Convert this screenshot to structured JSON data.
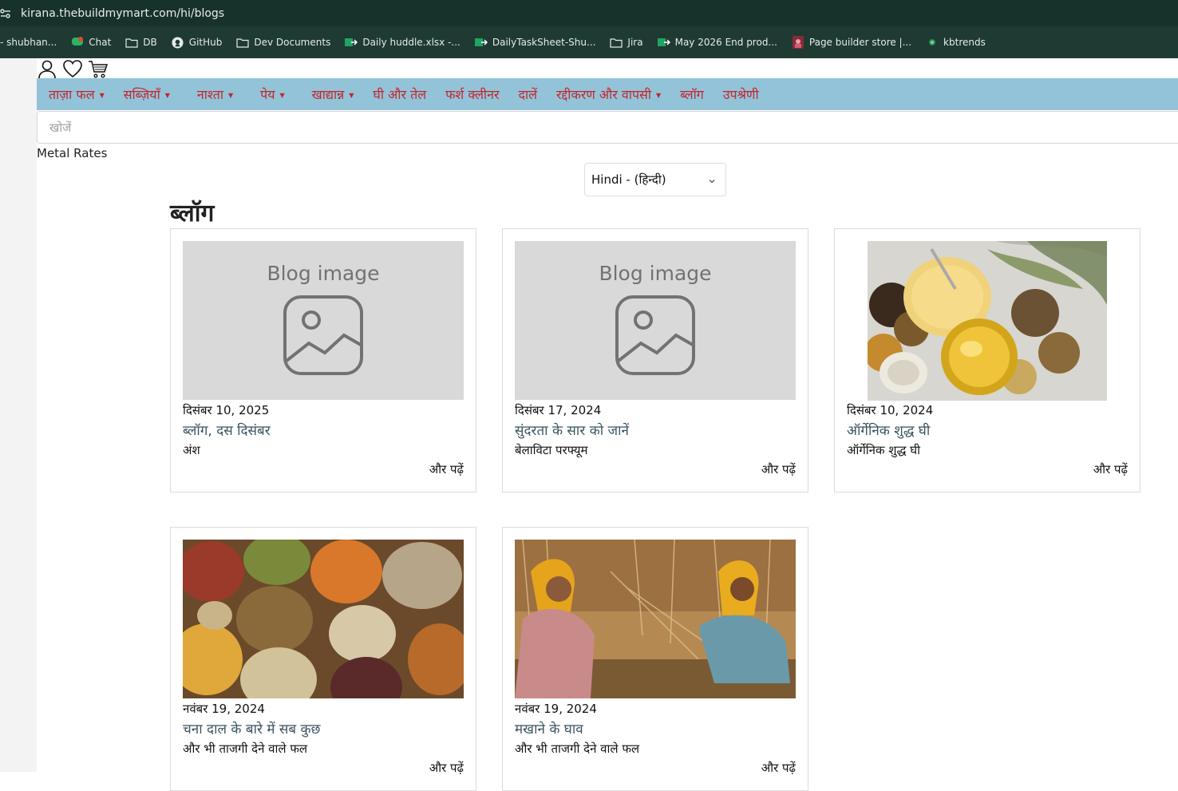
{
  "browser": {
    "url": "kirana.thebuildmymart.com/hi/blogs",
    "bookmarks": [
      {
        "label": "- shubhan...",
        "icon": "none"
      },
      {
        "label": "Chat",
        "icon": "chat-icon"
      },
      {
        "label": "DB",
        "icon": "folder-icon"
      },
      {
        "label": "GitHub",
        "icon": "github-icon"
      },
      {
        "label": "Dev Documents",
        "icon": "folder-icon"
      },
      {
        "label": "Daily huddle.xlsx -...",
        "icon": "sheet-icon"
      },
      {
        "label": "DailyTaskSheet-Shu...",
        "icon": "sheet-icon"
      },
      {
        "label": "Jira",
        "icon": "folder-icon"
      },
      {
        "label": "May 2026 End prod...",
        "icon": "sheet-icon"
      },
      {
        "label": "Page builder store |...",
        "icon": "store-icon"
      },
      {
        "label": "kbtrends",
        "icon": "leaf-icon"
      }
    ]
  },
  "nav": {
    "items": [
      {
        "label": "ताज़ा फल",
        "dropdown": true
      },
      {
        "label": "सब्ज़ियाँ",
        "dropdown": true
      },
      {
        "label": "नाश्ता",
        "dropdown": true
      },
      {
        "label": "पेय",
        "dropdown": true
      },
      {
        "label": "खाद्यान्न",
        "dropdown": true
      },
      {
        "label": "घी और तेल",
        "dropdown": false
      },
      {
        "label": "फर्श क्लीनर",
        "dropdown": false
      },
      {
        "label": "दालें",
        "dropdown": false
      },
      {
        "label": "रद्दीकरण और वापसी",
        "dropdown": true
      },
      {
        "label": "ब्लॉग",
        "dropdown": false
      },
      {
        "label": "उपश्रेणी",
        "dropdown": false
      }
    ]
  },
  "search": {
    "placeholder": "खोजें"
  },
  "metal_rates": "Metal Rates",
  "language": {
    "selected": "Hindi - (हिन्दी)"
  },
  "page_title": "ब्लॉग",
  "placeholder_text": "Blog image",
  "colors": {
    "nav_bg": "#93c3d8",
    "nav_text": "#c2262e",
    "chrome_bg": "#17322b"
  },
  "posts": [
    {
      "date": "दिसंबर 10, 2025",
      "title": "ब्लॉग, दस दिसंबर",
      "excerpt": "अंश",
      "read_more": "और पढ़ें",
      "image": "placeholder"
    },
    {
      "date": "दिसंबर 17, 2024",
      "title": "सुंदरता के सार को जानें",
      "excerpt": "बेलाविटा परफ्यूम",
      "read_more": "और पढ़ें",
      "image": "placeholder"
    },
    {
      "date": "दिसंबर 10, 2024",
      "title": "ऑर्गेनिक शुद्ध घी",
      "excerpt": "ऑर्गेनिक शुद्ध घी",
      "read_more": "और पढ़ें",
      "image": "ghee-photo"
    },
    {
      "date": "नवंबर 19, 2024",
      "title": "चना दाल के बारे में सब कुछ",
      "excerpt": "और भी ताजगी देने वाले फल",
      "read_more": "और पढ़ें",
      "image": "grains-photo"
    },
    {
      "date": "नवंबर 19, 2024",
      "title": "मखाने के घाव",
      "excerpt": "और भी ताजगी देने वाले फल",
      "read_more": "और पढ़ें",
      "image": "harvest-photo"
    }
  ]
}
